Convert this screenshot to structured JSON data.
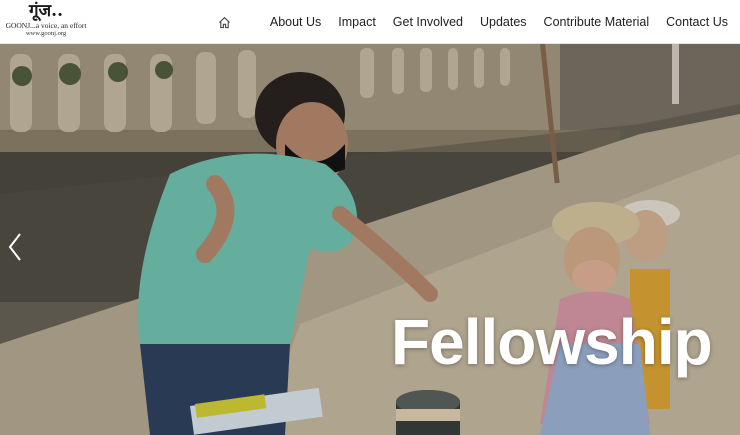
{
  "logo": {
    "mark": "गूंज..",
    "tagline": "GOONJ...a voice, an effort",
    "url": "www.goonj.org"
  },
  "nav": {
    "home_icon": "home-icon",
    "items": [
      {
        "label": "About Us"
      },
      {
        "label": "Impact"
      },
      {
        "label": "Get Involved"
      },
      {
        "label": "Updates"
      },
      {
        "label": "Contribute Material"
      },
      {
        "label": "Contact Us"
      }
    ]
  },
  "hero": {
    "title": "Fellowship",
    "prev_icon": "chevron-left-icon"
  },
  "colors": {
    "nav_bg": "#ffffff",
    "nav_text": "#222222",
    "hero_text": "#ffffff"
  }
}
